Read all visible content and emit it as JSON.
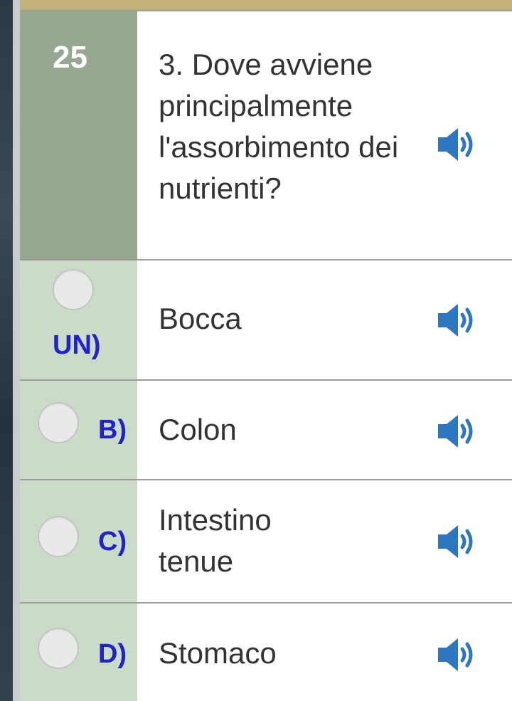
{
  "question": {
    "number": "25",
    "text": "3. Dove avviene principalmente l'assorbimento dei nutrienti?"
  },
  "answers": [
    {
      "letter": "UN)",
      "text": "Bocca"
    },
    {
      "letter": "B)",
      "text": "Colon"
    },
    {
      "letter": "C)",
      "text": "Intestino tenue"
    },
    {
      "letter": "D)",
      "text": "Stomaco"
    }
  ],
  "icons": {
    "audio": "speaker-icon"
  },
  "colors": {
    "question_number_bg": "#97a792",
    "answer_letter_bg": "#cadbc8",
    "letter": "#1f23c9",
    "speaker": "#2e76c0",
    "top_strip": "#c2b27a"
  }
}
